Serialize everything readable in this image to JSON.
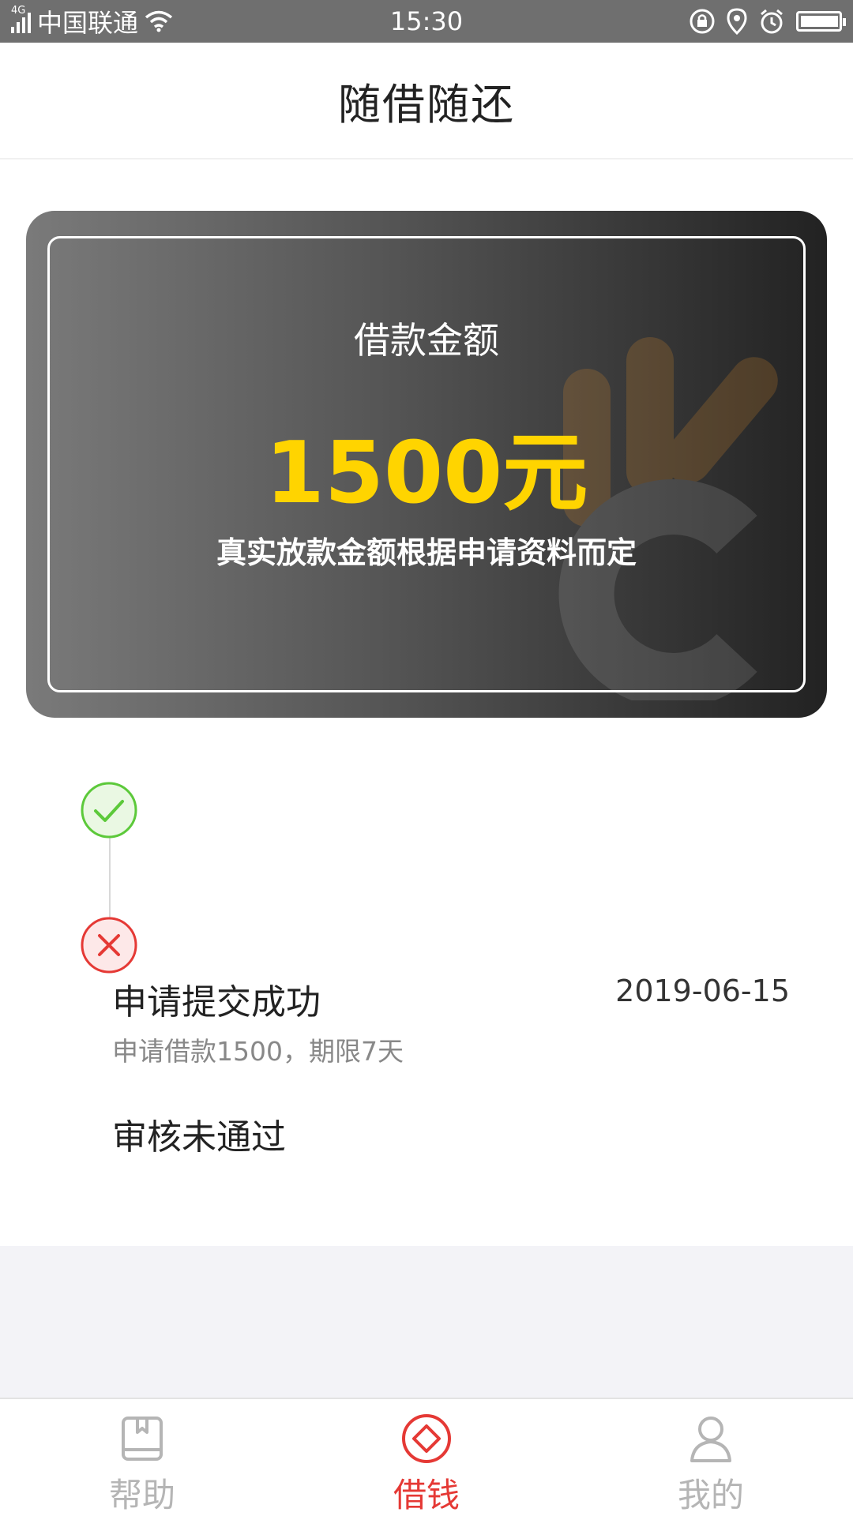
{
  "status_bar": {
    "network": "4G",
    "carrier": "中国联通",
    "time": "15:30"
  },
  "header": {
    "title": "随借随还"
  },
  "card": {
    "label": "借款金额",
    "amount": "1500元",
    "note": "真实放款金额根据申请资料而定"
  },
  "timeline": {
    "steps": [
      {
        "status": "success",
        "title": "申请提交成功",
        "date": "2019-06-15",
        "desc": "申请借款1500，期限7天"
      },
      {
        "status": "failed",
        "title": "审核未通过"
      }
    ]
  },
  "bottom_nav": {
    "items": [
      {
        "label": "帮助",
        "icon": "book-icon",
        "active": false
      },
      {
        "label": "借钱",
        "icon": "diamond-icon",
        "active": true
      },
      {
        "label": "我的",
        "icon": "user-icon",
        "active": false
      }
    ]
  },
  "colors": {
    "accent_red": "#e53935",
    "amount_yellow": "#ffd400",
    "success_green": "#5cc93a",
    "fail_red": "#e53935"
  }
}
